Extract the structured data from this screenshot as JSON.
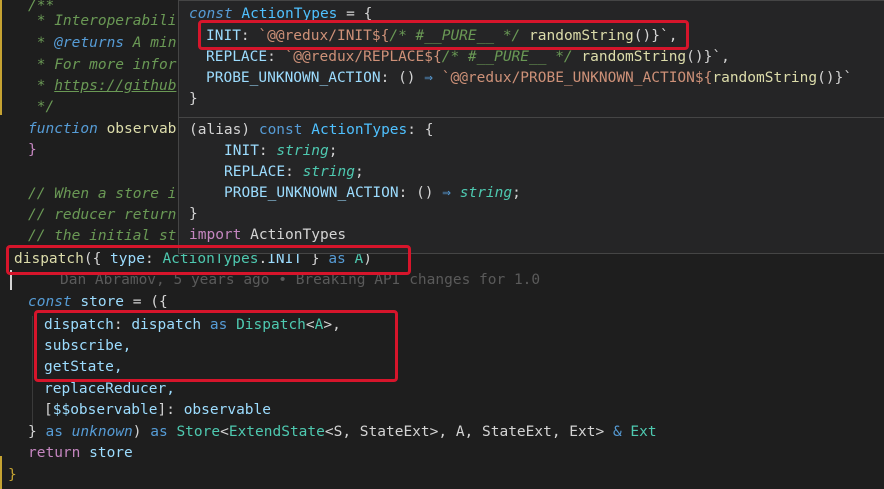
{
  "editor": {
    "lines": {
      "c1": "/**",
      "c2_star": " * ",
      "c2_text": "Interoperabili",
      "c3_star": " * ",
      "c3_tag": "@returns",
      "c3_text": " A min",
      "c4_star": " * ",
      "c4_text": "For more infor",
      "c5_star": " * ",
      "c5_link": "https://github",
      "c6": " */",
      "f1_kw": "function",
      "f1_name": " observab",
      "f2": "}",
      "b1": "// When a store i",
      "b2": "// reducer return",
      "b3": "// the initial st",
      "d1_fn": "dispatch",
      "d1_open": "({ ",
      "d1_prop": "type",
      "d1_colon": ": ",
      "d1_obj": "ActionTypes",
      "d1_dot": ".",
      "d1_const": "INIT",
      "d1_close": " } ",
      "d1_as": "as",
      "d1_type": " A",
      "d1_end": ")",
      "blame": "Dan Abramov, 5 years ago • Breaking API changes for 1.0",
      "s1_kw": "const",
      "s1_name": " store",
      "s1_rest": " = ({",
      "s2_prop": "dispatch",
      "s2_colon": ": ",
      "s2_val": "dispatch",
      "s2_as": " as ",
      "s2_type": "Dispatch",
      "s2_lt": "<",
      "s2_A": "A",
      "s2_gt": ">,",
      "s3": "subscribe,",
      "s4": "getState,",
      "s5": "replaceReducer,",
      "s6_open": "[",
      "s6_sym": "$$observable",
      "s6_close": "]: ",
      "s6_val": "observable",
      "s7_close": "} ",
      "s7_as": "as",
      "s7_unknown": " unknown",
      "s7_paren": ") ",
      "s7_as2": "as",
      "s7_store": " Store",
      "s7_lt": "<",
      "s7_ext": "ExtendState",
      "s7_args": "<S, StateExt>, A, StateExt, Ext> ",
      "s7_amp": "&",
      "s7_ext2": " Ext",
      "r1_kw": "return",
      "r1_val": " store",
      "end": "}"
    }
  },
  "hover": {
    "def": {
      "l1_kw": "const",
      "l1_name": " ActionTypes",
      "l1_rest": " = {",
      "l2_prop": "INIT",
      "l2_colon": ": ",
      "l2_str": "`@@redux/INIT${",
      "l2_com": "/* #__PURE__ */",
      "l2_fn": " randomString",
      "l2_end": "()}`,",
      "l3_prop": "REPLACE",
      "l3_colon": ": ",
      "l3_str": "`@@redux/REPLACE${",
      "l3_com": "/* #__PURE__ */",
      "l3_fn": " randomString",
      "l3_end": "()}`,",
      "l4_prop": "PROBE_UNKNOWN_ACTION",
      "l4_colon": ": () ",
      "l4_arrow": "⇒",
      "l4_str": " `@@redux/PROBE_UNKNOWN_ACTION${",
      "l4_fn": "randomString",
      "l4_end": "()}`",
      "l5": "}"
    },
    "sig": {
      "l1_open": "(alias) ",
      "l1_kw": "const",
      "l1_name": " ActionTypes",
      "l1_rest": ": {",
      "l2_prop": "INIT",
      "l2_colon": ": ",
      "l2_type": "string",
      "l2_end": ";",
      "l3_prop": "REPLACE",
      "l3_colon": ": ",
      "l3_type": "string",
      "l3_end": ";",
      "l4_prop": "PROBE_UNKNOWN_ACTION",
      "l4_colon": ": () ",
      "l4_arrow": "⇒",
      "l4_type": " string",
      "l4_end": ";",
      "l5": "}",
      "l6_kw": "import",
      "l6_name": " ActionTypes"
    }
  },
  "colors": {
    "highlight_box": "#d6152b",
    "background": "#1e1e1e",
    "hover_background": "#252526"
  }
}
